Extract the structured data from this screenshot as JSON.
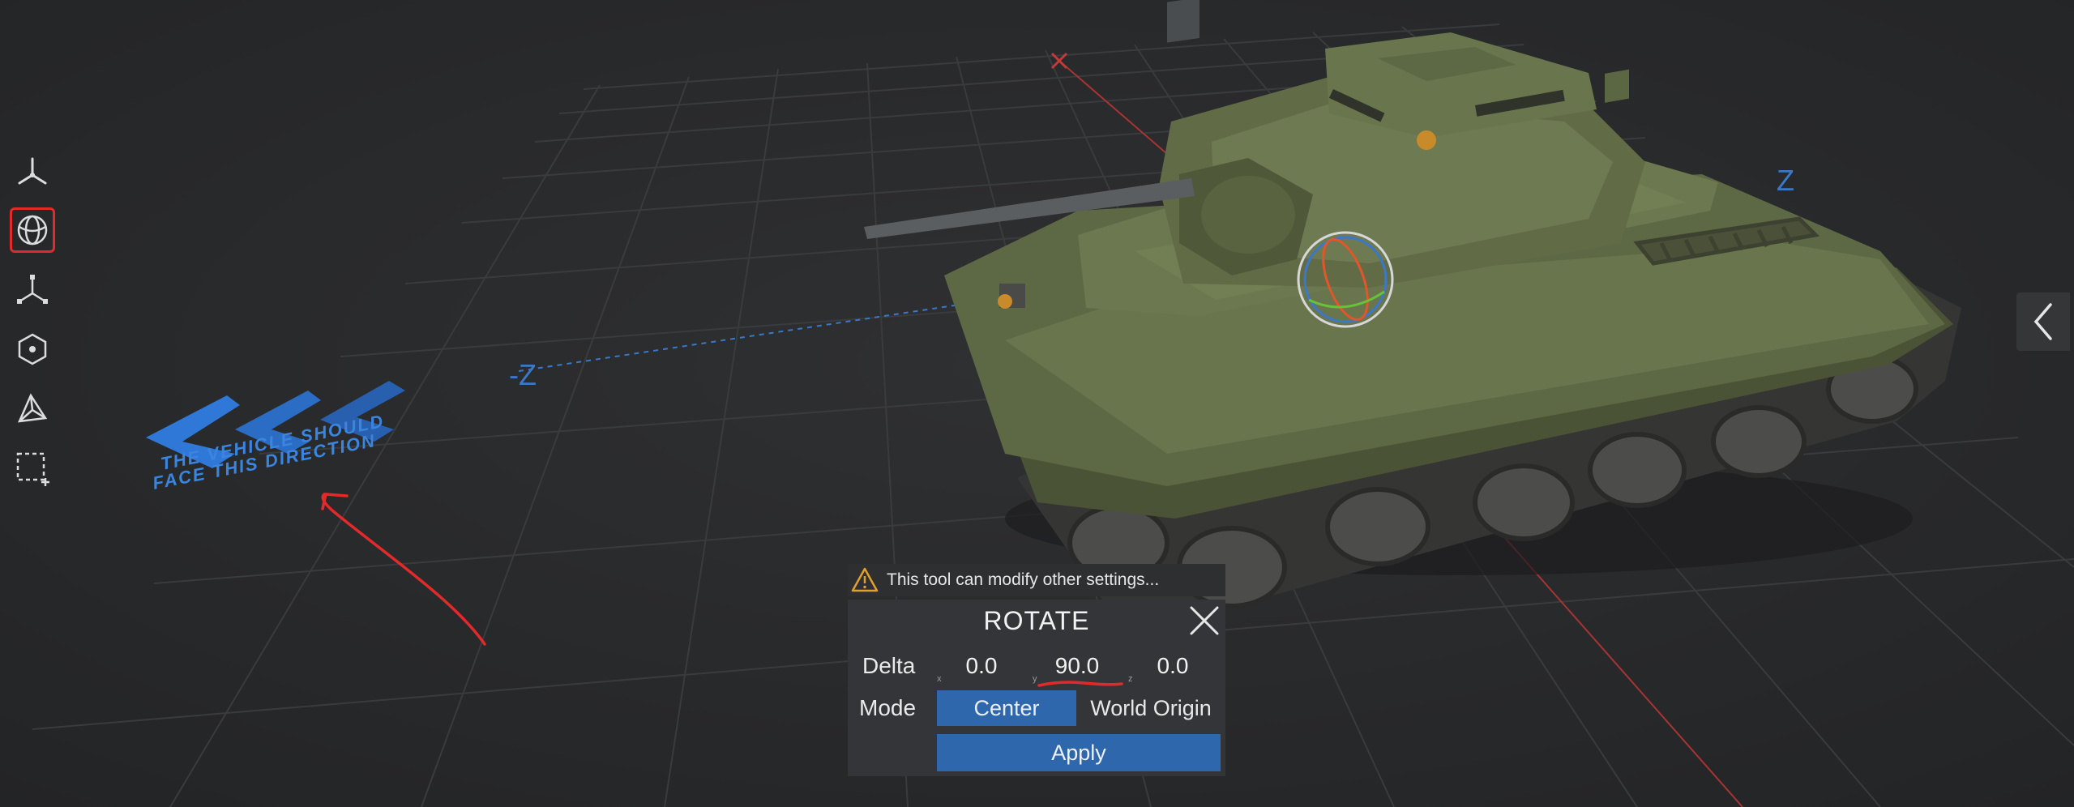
{
  "viewport": {
    "axis_labels": {
      "neg_z": "-Z",
      "pos_z": "Z"
    },
    "direction_sign": {
      "line1": "THE VEHICLE SHOULD",
      "line2": "FACE THIS DIRECTION"
    }
  },
  "toolbar": {
    "tools": [
      {
        "name": "move-tool",
        "icon": "axes-icon",
        "active": false
      },
      {
        "name": "rotate-tool",
        "icon": "sphere-icon",
        "active": true
      },
      {
        "name": "scale-tool",
        "icon": "scale-axes-icon",
        "active": false
      },
      {
        "name": "pivot-tool",
        "icon": "hexagon-dot-icon",
        "active": false
      },
      {
        "name": "vertex-tool",
        "icon": "vertex-icon",
        "active": false
      },
      {
        "name": "select-tool",
        "icon": "selection-box-icon",
        "active": false
      }
    ]
  },
  "warning": {
    "text": "This tool can modify other settings..."
  },
  "rotate_panel": {
    "title": "ROTATE",
    "delta_label": "Delta",
    "delta": {
      "x": {
        "axis": "x",
        "value": "0.0"
      },
      "y": {
        "axis": "y",
        "value": "90.0"
      },
      "z": {
        "axis": "z",
        "value": "0.0"
      }
    },
    "mode_label": "Mode",
    "mode_options": [
      "Center",
      "World Origin"
    ],
    "mode_selected": "Center",
    "apply_label": "Apply"
  },
  "colors": {
    "accent": "#2f67ad",
    "annotation": "#e22a2a",
    "axis_blue": "#3b78c9",
    "axis_red": "#c43a3a",
    "warning": "#e0a12b",
    "background": "#2a2b2d",
    "tank": "#5d6845"
  }
}
